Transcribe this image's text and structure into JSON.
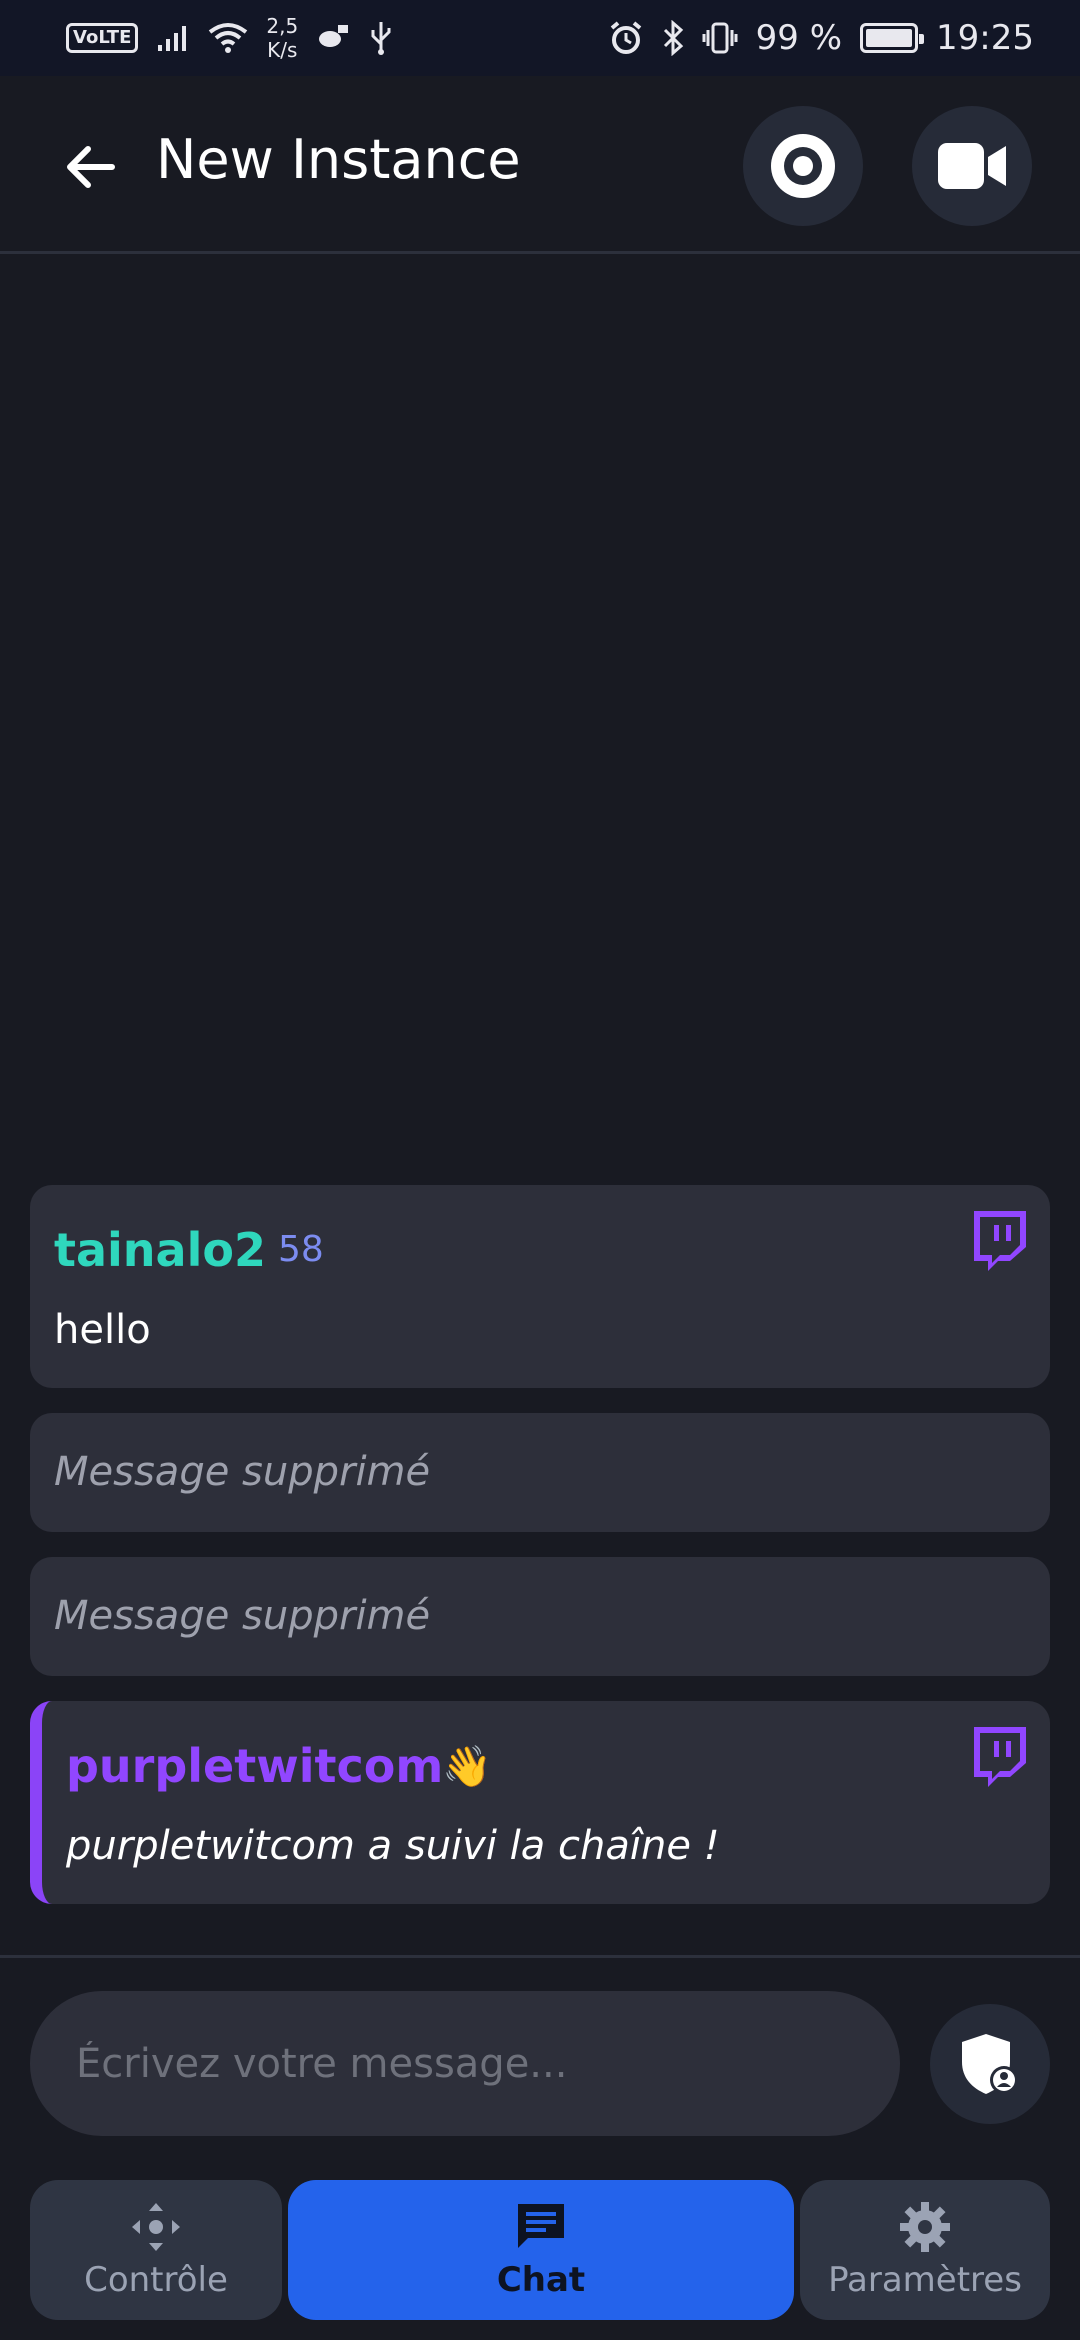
{
  "status_bar": {
    "network_badge": "VoLTE",
    "net_speed_value": "2,5",
    "net_speed_unit": "K/s",
    "battery": "99 %",
    "time": "19:25",
    "icons": [
      "signal-icon",
      "wifi-icon",
      "app-notification-icon",
      "usb-icon",
      "alarm-icon",
      "bluetooth-icon",
      "vibrate-icon",
      "battery-charging-icon"
    ]
  },
  "header": {
    "title": "New Instance",
    "back_icon": "arrow-left-icon",
    "record_icon": "record-icon",
    "camera_icon": "video-camera-icon"
  },
  "messages": [
    {
      "user": "tainalo2",
      "badge": "58",
      "text": "hello",
      "platform": "twitch",
      "user_color": "#2fd7bd"
    },
    {
      "deleted_text": "Message supprimé"
    },
    {
      "deleted_text": "Message supprimé"
    },
    {
      "user": "purpletwitcom",
      "emoji": "👋",
      "text": "purpletwitcom a suivi la chaîne !",
      "platform": "twitch",
      "user_color": "#9146ff",
      "highlight_color": "#8b44f7"
    }
  ],
  "input": {
    "placeholder": "Écrivez votre message...",
    "value": ""
  },
  "nav": {
    "control_label": "Contrôle",
    "chat_label": "Chat",
    "settings_label": "Paramètres",
    "active": "Chat"
  },
  "colors": {
    "background": "#181a22",
    "card": "#2d2f3a",
    "accent_blue": "#2463eb",
    "twitch_purple": "#9146ff"
  }
}
